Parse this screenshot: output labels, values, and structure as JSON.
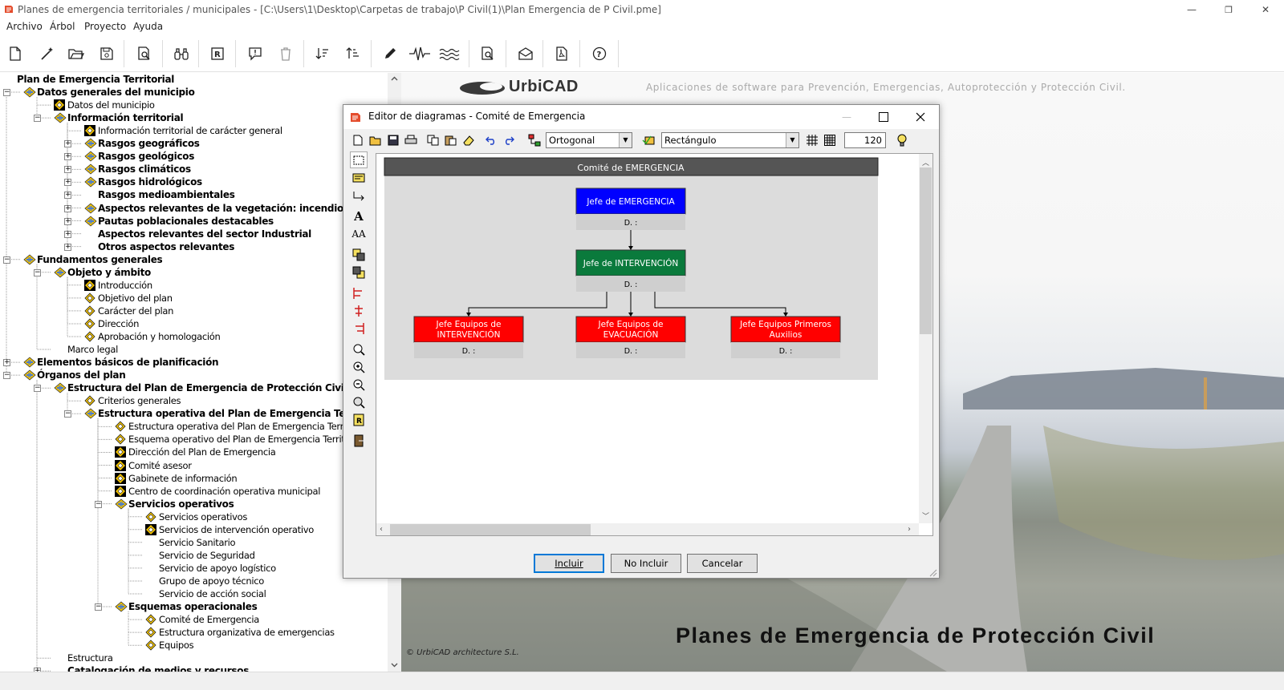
{
  "window": {
    "title": "Planes de emergencia territoriales / municipales - [C:\\Users\\1\\Desktop\\Carpetas de trabajo\\P Civil(1)\\Plan Emergencia de P Civil.pme]",
    "minimize": "—",
    "restore": "❐",
    "close": "✕"
  },
  "menu": [
    "Archivo",
    "Árbol",
    "Proyecto",
    "Ayuda"
  ],
  "toolbar_icons": [
    "new-file-icon",
    "magic-wand-icon",
    "open-folder-icon",
    "save-icon",
    "print-preview-icon",
    "binoculars-icon",
    "report-icon",
    "comment-icon",
    "delete-icon",
    "sort-descending-icon",
    "sort-ascending-icon",
    "pencil-icon",
    "seismic-icon",
    "flood-icon",
    "document-search-icon",
    "envelope-icon",
    "pdf-icon",
    "help-icon"
  ],
  "tree": [
    {
      "level": 0,
      "label": "Plan de Emergencia Territorial",
      "bold": true,
      "icon": "none",
      "exp": "none"
    },
    {
      "level": 0,
      "label": "Datos generales del municipio",
      "bold": true,
      "icon": "folder",
      "exp": "minus"
    },
    {
      "level": 1,
      "label": "Datos del municipio",
      "bold": false,
      "icon": "leaf-dark",
      "exp": "none"
    },
    {
      "level": 1,
      "label": "Información territorial",
      "bold": true,
      "icon": "folder",
      "exp": "minus"
    },
    {
      "level": 2,
      "label": "Información territorial de carácter general",
      "bold": false,
      "icon": "leaf-dark",
      "exp": "none"
    },
    {
      "level": 2,
      "label": "Rasgos geográficos",
      "bold": true,
      "icon": "folder",
      "exp": "plus"
    },
    {
      "level": 2,
      "label": "Rasgos geológicos",
      "bold": true,
      "icon": "folder",
      "exp": "plus"
    },
    {
      "level": 2,
      "label": "Rasgos climáticos",
      "bold": true,
      "icon": "folder",
      "exp": "plus"
    },
    {
      "level": 2,
      "label": "Rasgos hidrológicos",
      "bold": true,
      "icon": "folder",
      "exp": "plus"
    },
    {
      "level": 2,
      "label": "Rasgos medioambientales",
      "bold": true,
      "icon": "none",
      "exp": "plus"
    },
    {
      "level": 2,
      "label": "Aspectos relevantes de la vegetación: incendios fo",
      "bold": true,
      "icon": "folder",
      "exp": "plus"
    },
    {
      "level": 2,
      "label": "Pautas poblacionales destacables",
      "bold": true,
      "icon": "folder",
      "exp": "plus"
    },
    {
      "level": 2,
      "label": "Aspectos relevantes del sector Industrial",
      "bold": true,
      "icon": "none",
      "exp": "plus"
    },
    {
      "level": 2,
      "label": "Otros aspectos relevantes",
      "bold": true,
      "icon": "none",
      "exp": "plus"
    },
    {
      "level": 0,
      "label": "Fundamentos generales",
      "bold": true,
      "icon": "folder",
      "exp": "minus"
    },
    {
      "level": 1,
      "label": "Objeto y ámbito",
      "bold": true,
      "icon": "folder",
      "exp": "minus"
    },
    {
      "level": 2,
      "label": "Introducción",
      "bold": false,
      "icon": "leaf-dark",
      "exp": "none"
    },
    {
      "level": 2,
      "label": "Objetivo del plan",
      "bold": false,
      "icon": "leaf",
      "exp": "none"
    },
    {
      "level": 2,
      "label": "Carácter del plan",
      "bold": false,
      "icon": "leaf",
      "exp": "none"
    },
    {
      "level": 2,
      "label": "Dirección",
      "bold": false,
      "icon": "leaf",
      "exp": "none"
    },
    {
      "level": 2,
      "label": "Aprobación y homologación",
      "bold": false,
      "icon": "leaf",
      "exp": "none"
    },
    {
      "level": 1,
      "label": "Marco legal",
      "bold": false,
      "icon": "none",
      "exp": "none"
    },
    {
      "level": 0,
      "label": "Elementos básicos de planificación",
      "bold": true,
      "icon": "folder",
      "exp": "plus"
    },
    {
      "level": 0,
      "label": "Órganos del plan",
      "bold": true,
      "icon": "folder",
      "exp": "minus"
    },
    {
      "level": 1,
      "label": "Estructura del Plan de Emergencia de Protección Civil",
      "bold": true,
      "icon": "folder",
      "exp": "minus"
    },
    {
      "level": 2,
      "label": "Criterios generales",
      "bold": false,
      "icon": "leaf",
      "exp": "none"
    },
    {
      "level": 2,
      "label": "Estructura operativa del Plan de Emergencia Territo",
      "bold": true,
      "icon": "folder",
      "exp": "minus"
    },
    {
      "level": 3,
      "label": "Estructura operativa del Plan de Emergencia Territorial",
      "bold": false,
      "icon": "leaf",
      "exp": "none"
    },
    {
      "level": 3,
      "label": "Esquema operativo del Plan de Emergencia Territorial",
      "bold": false,
      "icon": "leaf",
      "exp": "none"
    },
    {
      "level": 3,
      "label": "Dirección del Plan de Emergencia",
      "bold": false,
      "icon": "leaf-dark",
      "exp": "none"
    },
    {
      "level": 3,
      "label": "Comité asesor",
      "bold": false,
      "icon": "leaf-dark",
      "exp": "none"
    },
    {
      "level": 3,
      "label": "Gabinete de información",
      "bold": false,
      "icon": "leaf-dark",
      "exp": "none"
    },
    {
      "level": 3,
      "label": "Centro de coordinación operativa municipal",
      "bold": false,
      "icon": "leaf-dark",
      "exp": "none"
    },
    {
      "level": 3,
      "label": "Servicios operativos",
      "bold": true,
      "icon": "folder",
      "exp": "minus"
    },
    {
      "level": 4,
      "label": "Servicios operativos",
      "bold": false,
      "icon": "leaf",
      "exp": "none"
    },
    {
      "level": 4,
      "label": "Servicios de intervención operativo",
      "bold": false,
      "icon": "leaf-dark",
      "exp": "none"
    },
    {
      "level": 4,
      "label": "Servicio Sanitario",
      "bold": false,
      "icon": "none",
      "exp": "none"
    },
    {
      "level": 4,
      "label": "Servicio de Seguridad",
      "bold": false,
      "icon": "none",
      "exp": "none"
    },
    {
      "level": 4,
      "label": "Servicio de apoyo logístico",
      "bold": false,
      "icon": "none",
      "exp": "none"
    },
    {
      "level": 4,
      "label": "Grupo de apoyo técnico",
      "bold": false,
      "icon": "none",
      "exp": "none"
    },
    {
      "level": 4,
      "label": "Servicio de acción social",
      "bold": false,
      "icon": "none",
      "exp": "none"
    },
    {
      "level": 3,
      "label": "Esquemas operacionales",
      "bold": true,
      "icon": "folder",
      "exp": "minus"
    },
    {
      "level": 4,
      "label": "Comité de Emergencia",
      "bold": false,
      "icon": "leaf",
      "exp": "none"
    },
    {
      "level": 4,
      "label": "Estructura organizativa de emergencias",
      "bold": false,
      "icon": "leaf",
      "exp": "none"
    },
    {
      "level": 4,
      "label": "Equipos",
      "bold": false,
      "icon": "leaf",
      "exp": "none"
    },
    {
      "level": 1,
      "label": "Estructura",
      "bold": false,
      "icon": "none",
      "exp": "none"
    },
    {
      "level": 1,
      "label": "Catalogación de medios y recursos",
      "bold": true,
      "icon": "none",
      "exp": "plus"
    }
  ],
  "background": {
    "brand": "UrbiCAD",
    "tagline": "Aplicaciones de software para Prevención, Emergencias, Autoprotección y Protección Civil.",
    "banner": "Planes de Emergencia de Protección Civil",
    "footer": "© UrbiCAD architecture S.L."
  },
  "dialog": {
    "title": "Editor de diagramas - Comité de Emergencia",
    "connector_combo": "Ortogonal",
    "shape_combo": "Rectángulo",
    "zoom_value": "120",
    "buttons": {
      "include": "Incluir",
      "not_include": "No Incluir",
      "cancel": "Cancelar"
    }
  },
  "diagram": {
    "header": "Comité de EMERGENCIA",
    "nodes": [
      {
        "id": "jefe-emergencia",
        "label1": "Jefe de EMERGENCIA",
        "label2": "",
        "sub": "D. :",
        "color": "#0000ff"
      },
      {
        "id": "jefe-intervencion",
        "label1": "Jefe de INTERVENCIÓN",
        "label2": "",
        "sub": "D. :",
        "color": "#0a7a3c"
      },
      {
        "id": "equipos-intervencion",
        "label1": "Jefe Equipos de",
        "label2": "INTERVENCIÓN",
        "sub": "D. :",
        "color": "#ff0000"
      },
      {
        "id": "equipos-evacuacion",
        "label1": "Jefe Equipos de",
        "label2": "EVACUACIÓN",
        "sub": "D. :",
        "color": "#ff0000"
      },
      {
        "id": "equipos-auxilios",
        "label1": "Jefe Equipos Primeros",
        "label2": "Auxilios",
        "sub": "D. :",
        "color": "#ff0000"
      }
    ],
    "edges": [
      [
        "jefe-emergencia",
        "jefe-intervencion"
      ],
      [
        "jefe-intervencion",
        "equipos-intervencion"
      ],
      [
        "jefe-intervencion",
        "equipos-evacuacion"
      ],
      [
        "jefe-intervencion",
        "equipos-auxilios"
      ]
    ]
  }
}
